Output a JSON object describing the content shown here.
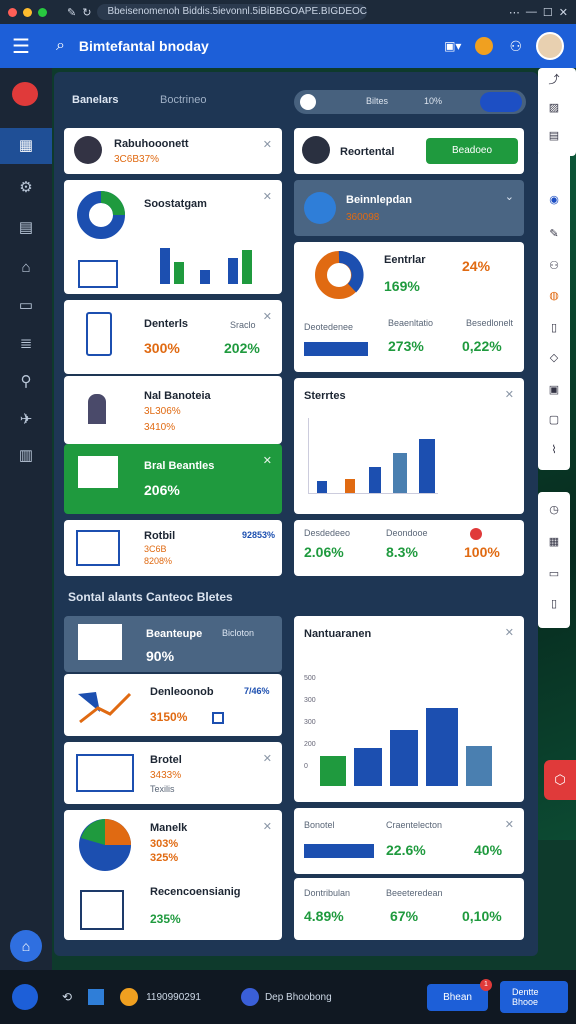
{
  "browser": {
    "url": "Bbeisenomenoh Biddis.5ievonnl.5iBiBBGOAPE.BIGDEOCF",
    "ctrl_icons": [
      "more-icon",
      "minimize-icon",
      "maximize-icon",
      "close-icon"
    ]
  },
  "appbar": {
    "title": "Bimtefantal bnoday"
  },
  "tabs": {
    "left": "Banelars",
    "right": "Boctrineo",
    "seg1": "Biltes",
    "seg2": "10%"
  },
  "cards": {
    "c1": {
      "title": "Rabuhooonett",
      "value": "3C6B37%"
    },
    "c2": {
      "title": "Soostatgam"
    },
    "c3": {
      "title": "Denterls",
      "sub": "Sraclo",
      "v1": "300%",
      "v2": "202%"
    },
    "c4": {
      "title": "Nal Banoteia",
      "v1": "3L306%",
      "v2": "3410%"
    },
    "c5": {
      "title": "Bral Beantles",
      "v1": "206%"
    },
    "c6": {
      "title": "Rotbil",
      "v1": "3C6B",
      "v2": "8208%",
      "badge": "92853%"
    },
    "r1": {
      "title": "Reortental",
      "button": "Beadoeo"
    },
    "r2": {
      "title": "Beinnlepdan",
      "value": "360098"
    },
    "r3": {
      "title": "Eentrlar",
      "v1": "24%",
      "v2": "169%"
    },
    "r3b": {
      "l1": "Deotedenee",
      "l2": "Beaenltatio",
      "l3": "Besedlonelt",
      "v1": "273%",
      "v2": "0,22%"
    },
    "r4": {
      "title": "Sterrtes"
    },
    "r5": {
      "l1": "Desdedeeo",
      "l2": "Deondooe",
      "v1": "2.06%",
      "v2": "8.3%",
      "v3": "100%"
    }
  },
  "section2": {
    "heading": "Sontal alants Canteoc Bletes"
  },
  "cards2": {
    "a1": {
      "title": "Beanteupe",
      "badge": "Bicloton",
      "value": "90%"
    },
    "a2": {
      "title": "Denleoonob",
      "v1": "3150%",
      "badge": "7/46%"
    },
    "a3": {
      "title": "Brotel",
      "v1": "3433%",
      "v2": "Texilis"
    },
    "a4": {
      "title": "Manelk",
      "v1": "303%",
      "v2": "325%"
    },
    "a5": {
      "title": "Recencoensianig",
      "v1": "235%"
    },
    "b1": {
      "title": "Nantuaranen",
      "ticks": [
        "500",
        "300",
        "300",
        "200",
        "0"
      ]
    },
    "b2": {
      "title": "Bonotel",
      "l2": "Craentelecton",
      "v1": "22.6%",
      "v2": "40%"
    },
    "b3": {
      "l1": "Dontribulan",
      "l2": "Beeeteredean",
      "v1": "4.89%",
      "v2": "67%",
      "v3": "0,10%"
    }
  },
  "taskbar": {
    "time": "1190990291",
    "app": "Dep Bhoobong",
    "btn1": "Bhean",
    "btn2": "Dentte Bhooe",
    "badge": "1"
  }
}
